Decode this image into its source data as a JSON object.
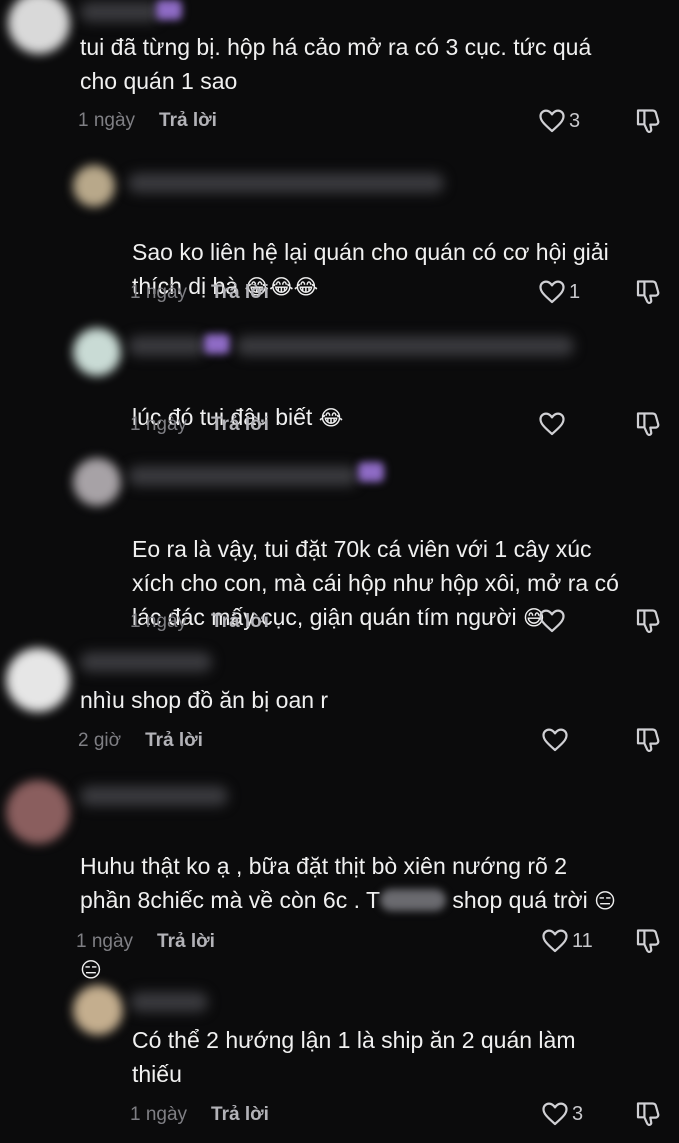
{
  "reply_label": "Trả lời",
  "comments": [
    {
      "text": "tui đã từng bị. hộp há cảo mở ra có 3 cục. tức quá\ncho quán 1 sao",
      "time": "1 ngày",
      "likes": "3",
      "avatar_color": "#d9d9d9",
      "tag": true
    },
    {
      "text": "Sao ko liên hệ lại quán cho quán có cơ hội giải\nthích dị bà",
      "emoji": "😂😂😂",
      "time": "1 ngày",
      "likes": "1",
      "avatar_color": "#b8a88a"
    },
    {
      "text": "lúc đó tui đâu biết",
      "emoji": "😂",
      "time": "1 ngày",
      "likes": "",
      "avatar_color": "#c9dbd5",
      "tag": true
    },
    {
      "text": "Eo ra là vậy, tui đặt 70k cá viên với 1 cây xúc\nxích cho con, mà cái hộp như hộp xôi, mở ra có\nlác đác mấy cục, giận quán tím người",
      "emoji": "😅",
      "time": "1 ngày",
      "likes": "",
      "avatar_color": "#a7a2a6",
      "tag": true
    },
    {
      "text": "nhìu shop đồ ăn bị oan r",
      "time": "2 giờ",
      "likes": "",
      "avatar_color": "#e6e6e6"
    },
    {
      "text_before": "Huhu thật ko ạ , bữa đặt thịt bò xiên nướng rõ 2\nphần 8chiếc mà về còn 6c . T",
      "text_after": " shop quá trời ",
      "emoji": "😑",
      "emoji_line2": "😑",
      "time": "1 ngày",
      "likes": "11",
      "avatar_color": "#8a5e5e"
    },
    {
      "text": "Có thể 2 hướng lận 1 là ship ăn 2 quán làm\nthiếu",
      "time": "1 ngày",
      "likes": "3",
      "avatar_color": "#c4ae8e"
    }
  ]
}
